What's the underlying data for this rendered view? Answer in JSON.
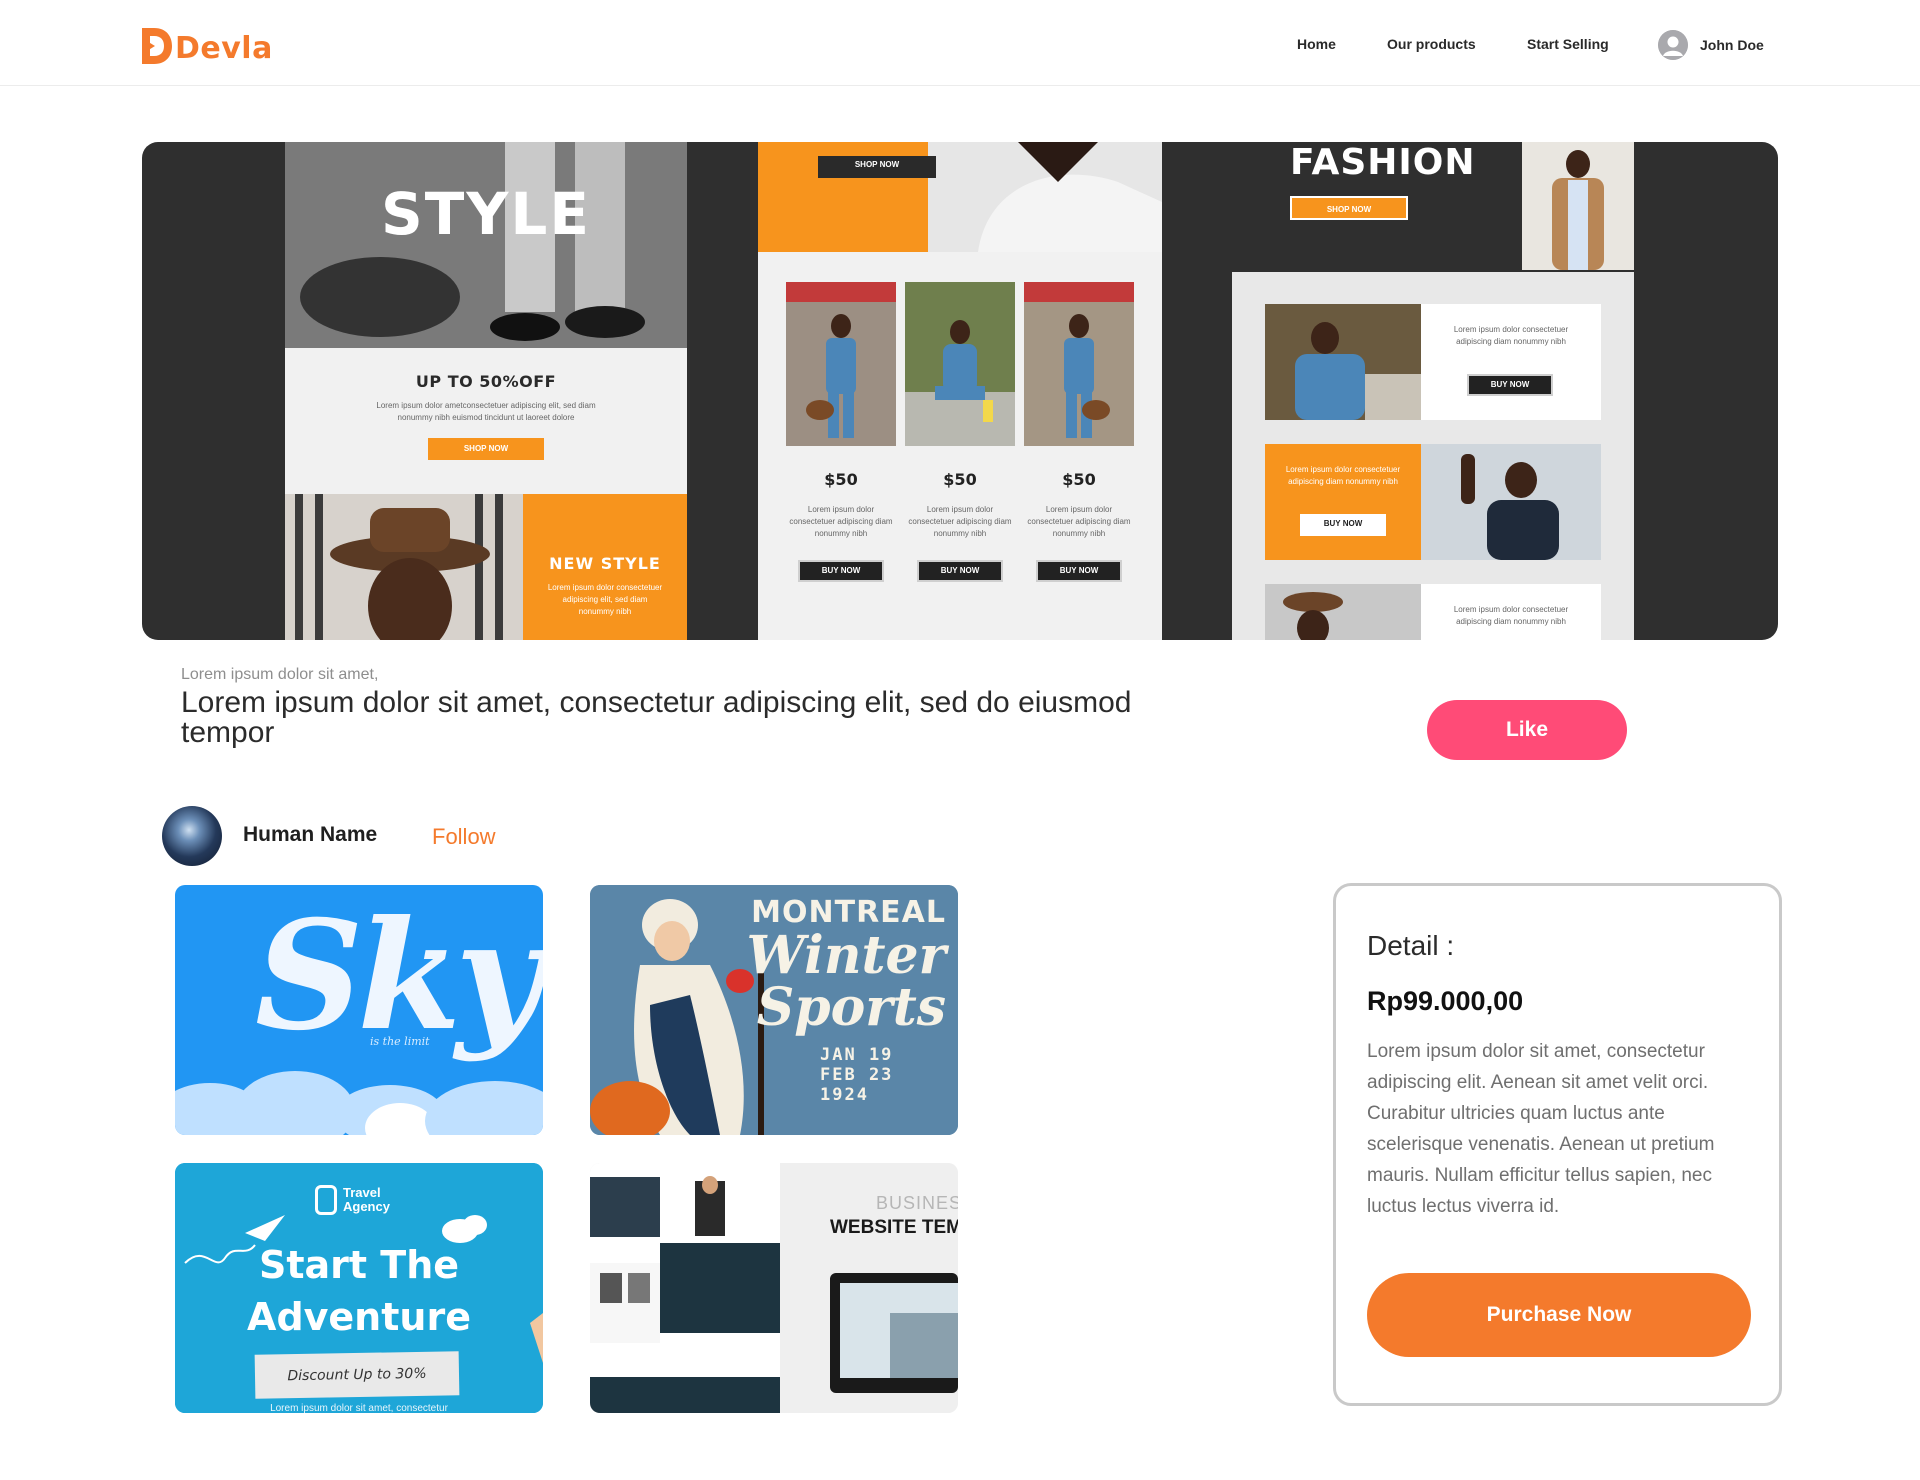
{
  "brand": {
    "name": "Devla",
    "logo_letter": "D",
    "accent": "#f47a2c"
  },
  "nav": {
    "links": [
      "Home",
      "Our products",
      "Start Selling"
    ],
    "user": {
      "name": "John Doe",
      "icon": "user-avatar-icon"
    }
  },
  "hero": {
    "panel1": {
      "headline": "STYLE",
      "sale": "UP TO 50%OFF",
      "body": "Lorem ipsum dolor ametconsectetuer adipiscing elit, sed diam nonummy nibh euismod tincidunt ut laoreet dolore",
      "cta": "SHOP NOW",
      "secondary_title": "NEW STYLE",
      "secondary_body": "Lorem ipsum dolor consectetuer adipiscing elit, sed diam nonummy nibh"
    },
    "panel2": {
      "cta_top": "SHOP NOW",
      "products": [
        {
          "price": "$50",
          "body": "Lorem ipsum dolor consectetuer adipiscing diam nonummy nibh",
          "cta": "BUY NOW"
        },
        {
          "price": "$50",
          "body": "Lorem ipsum dolor consectetuer adipiscing diam nonummy nibh",
          "cta": "BUY NOW"
        },
        {
          "price": "$50",
          "body": "Lorem ipsum dolor consectetuer adipiscing diam nonummy nibh",
          "cta": "BUY NOW"
        }
      ]
    },
    "panel3": {
      "headline": "FASHION",
      "cta_top": "SHOP NOW",
      "blocks": [
        {
          "body": "Lorem ipsum dolor consectetuer adipiscing diam nonummy nibh",
          "cta": "BUY NOW"
        },
        {
          "body": "Lorem ipsum dolor consectetuer adipiscing diam nonummy nibh",
          "cta": "BUY NOW"
        },
        {
          "body": "Lorem ipsum dolor consectetuer adipiscing diam nonummy nibh"
        }
      ]
    }
  },
  "product": {
    "subtitle": "Lorem ipsum dolor sit amet,",
    "title": "Lorem ipsum dolor sit amet, consectetur adipiscing elit, sed do eiusmod tempor",
    "like_label": "Like",
    "like_color": "#ff4b77"
  },
  "author": {
    "name": "Human Name",
    "follow_label": "Follow"
  },
  "gallery": [
    {
      "title": "Sky",
      "tagline": "is the limit"
    },
    {
      "city": "MONTREAL",
      "title_line1": "Winter",
      "title_line2": "Sports",
      "dates": [
        "JAN 19",
        "FEB 23",
        "1924"
      ]
    },
    {
      "brand": "Travel Agency",
      "brand_line1": "Travel",
      "brand_line2": "Agency",
      "title": "Start The Adventure",
      "title_line1": "Start The",
      "title_line2": "Adventure",
      "discount": "Discount Up to 30%",
      "footer": "Lorem ipsum dolor sit amet, consectetur"
    },
    {
      "category": "BUSINESS",
      "title": "WEBSITE TEMI"
    }
  ],
  "detail": {
    "label": "Detail :",
    "price": "Rp99.000,00",
    "description": "Lorem ipsum dolor sit amet, consectetur adipiscing elit. Aenean sit amet velit orci. Curabitur ultricies quam luctus ante scelerisque venenatis. Aenean ut pretium mauris. Nullam efficitur tellus sapien, nec luctus lectus viverra id.",
    "purchase_label": "Purchase Now"
  }
}
